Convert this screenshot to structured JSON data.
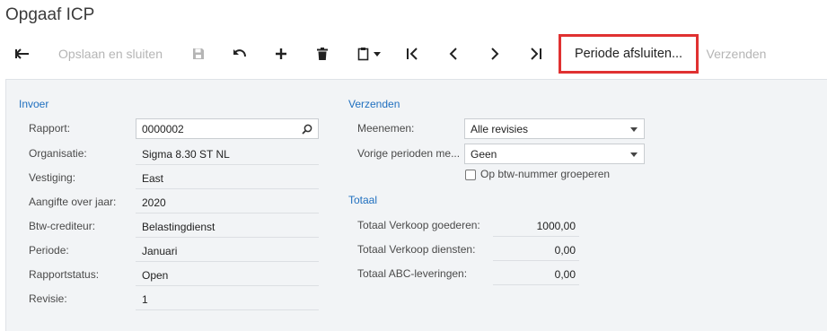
{
  "page": {
    "title": "Opgaaf ICP"
  },
  "toolbar": {
    "save_close": "Opslaan en sluiten",
    "close_period": "Periode afsluiten...",
    "send": "Verzenden"
  },
  "invoer": {
    "title": "Invoer",
    "fields": [
      {
        "label": "Rapport:",
        "value": "0000002"
      },
      {
        "label": "Organisatie:",
        "value": "Sigma 8.30 ST NL"
      },
      {
        "label": "Vestiging:",
        "value": "East"
      },
      {
        "label": "Aangifte over jaar:",
        "value": "2020"
      },
      {
        "label": "Btw-crediteur:",
        "value": "Belastingdienst"
      },
      {
        "label": "Periode:",
        "value": "Januari"
      },
      {
        "label": "Rapportstatus:",
        "value": "Open"
      },
      {
        "label": "Revisie:",
        "value": "1"
      }
    ]
  },
  "verzenden": {
    "title": "Verzenden",
    "meenemen_label": "Meenemen:",
    "meenemen_value": "Alle revisies",
    "vorige_label": "Vorige perioden me...",
    "vorige_value": "Geen",
    "group_checkbox_label": "Op btw-nummer groeperen",
    "group_checked": false
  },
  "totaal": {
    "title": "Totaal",
    "rows": [
      {
        "label": "Totaal Verkoop goederen:",
        "value": "1000,00"
      },
      {
        "label": "Totaal Verkoop diensten:",
        "value": "0,00"
      },
      {
        "label": "Totaal ABC-leveringen:",
        "value": "0,00"
      }
    ]
  },
  "colors": {
    "accent": "#1f6fbf",
    "highlight": "#e03131",
    "disabled": "#b5b5b5"
  }
}
